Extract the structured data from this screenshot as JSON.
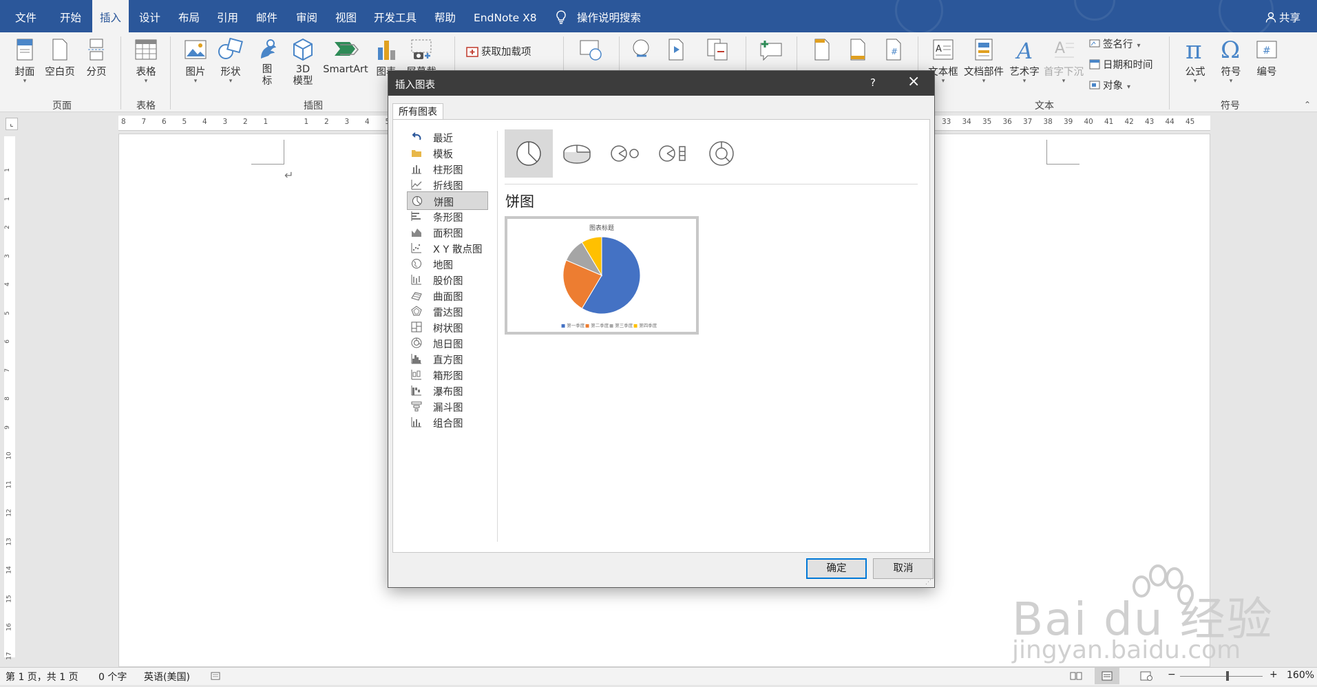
{
  "menu": {
    "tabs": [
      "文件",
      "开始",
      "插入",
      "设计",
      "布局",
      "引用",
      "邮件",
      "审阅",
      "视图",
      "开发工具",
      "帮助",
      "EndNote X8"
    ],
    "active_tab": "插入",
    "tell_me": "操作说明搜索",
    "share": "共享"
  },
  "ribbon": {
    "pages": {
      "cover": "封面",
      "blank": "空白页",
      "break": "分页",
      "group": "页面"
    },
    "tables": {
      "table": "表格",
      "group": "表格"
    },
    "illustrations": {
      "picture": "图片",
      "shapes": "形状",
      "icons_1": "图",
      "icons_2": "标",
      "model_1": "3D",
      "model_2": "模型",
      "smartart": "SmartArt",
      "chart": "图表",
      "screenshot": "屏幕截图",
      "group": "插图"
    },
    "addins": {
      "get": "获取加载项"
    },
    "text": {
      "textbox": "文本框",
      "quickparts": "文档部件",
      "wordart": "艺术字",
      "dropcap": "首字下沉",
      "signature": "签名行",
      "datetime": "日期和时间",
      "object": "对象",
      "group": "文本"
    },
    "symbols": {
      "equation": "公式",
      "symbol": "符号",
      "number": "编号",
      "group": "符号"
    }
  },
  "rulers": {
    "h_ticks": [
      "8",
      "7",
      "6",
      "5",
      "4",
      "3",
      "2",
      "1",
      "",
      "1",
      "2",
      "3",
      "4",
      "5",
      "33",
      "34",
      "35",
      "36",
      "37",
      "38",
      "39",
      "40",
      "41",
      "42",
      "43",
      "44",
      "45"
    ],
    "v_ticks": [
      "1",
      "1",
      "2",
      "3",
      "4",
      "5",
      "6",
      "7",
      "8",
      "9",
      "10",
      "11",
      "12",
      "13",
      "14",
      "15",
      "16",
      "17"
    ]
  },
  "dialog": {
    "title": "插入图表",
    "help": "?",
    "tab": "所有图表",
    "categories": [
      "最近",
      "模板",
      "柱形图",
      "折线图",
      "饼图",
      "条形图",
      "面积图",
      "X Y 散点图",
      "地图",
      "股价图",
      "曲面图",
      "雷达图",
      "树状图",
      "旭日图",
      "直方图",
      "箱形图",
      "瀑布图",
      "漏斗图",
      "组合图"
    ],
    "selected_category": "饼图",
    "subtypes": [
      "pie-icon",
      "3d-pie-icon",
      "pie-of-pie-icon",
      "bar-of-pie-icon",
      "doughnut-icon"
    ],
    "selected_subtype": 0,
    "preview_heading": "饼图",
    "preview_chart_title": "图表标题",
    "preview_legend": [
      "第一季度",
      "第二季度",
      "第三季度",
      "第四季度"
    ],
    "ok": "确定",
    "cancel": "取消"
  },
  "chart_data": {
    "type": "pie",
    "title": "图表标题",
    "categories": [
      "第一季度",
      "第二季度",
      "第三季度",
      "第四季度"
    ],
    "values": [
      8.2,
      3.2,
      1.4,
      1.2
    ],
    "colors": [
      "#4472c4",
      "#ed7d31",
      "#a5a5a5",
      "#ffc000"
    ],
    "legend": "bottom"
  },
  "status": {
    "page": "第 1 页，共 1 页",
    "words": "0 个字",
    "lang": "英语(美国)",
    "zoom": "160%"
  },
  "watermark": {
    "brand": "Bai du 经验",
    "url": "jingyan.baidu.com"
  },
  "colors": {
    "accent": "#2b579a",
    "dialog_title": "#3c3c3c"
  }
}
